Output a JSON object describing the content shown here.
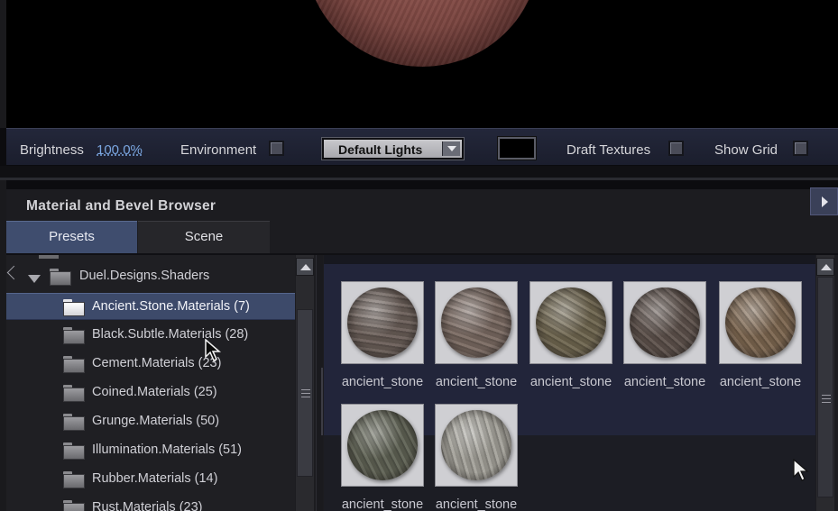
{
  "toolbar": {
    "brightness_label": "Brightness",
    "brightness_value": "100.0%",
    "environment_label": "Environment",
    "lights_dropdown": "Default Lights",
    "draft_textures_label": "Draft Textures",
    "show_grid_label": "Show Grid"
  },
  "browser": {
    "title": "Material and Bevel Browser",
    "tabs": [
      {
        "label": "Presets",
        "active": true
      },
      {
        "label": "Scene",
        "active": false
      }
    ],
    "tree": {
      "parent": "Duel.Designs.Shaders",
      "items": [
        {
          "label": "Ancient.Stone.Materials (7)",
          "selected": true
        },
        {
          "label": "Black.Subtle.Materials (28)",
          "selected": false
        },
        {
          "label": "Cement.Materials (23)",
          "selected": false
        },
        {
          "label": "Coined.Materials (25)",
          "selected": false
        },
        {
          "label": "Grunge.Materials (50)",
          "selected": false
        },
        {
          "label": "Illumination.Materials (51)",
          "selected": false
        },
        {
          "label": "Rubber.Materials (14)",
          "selected": false
        },
        {
          "label": "Rust.Materials (23)",
          "selected": false
        }
      ]
    },
    "materials": [
      {
        "label": "ancient_stone",
        "tone": "#6a5e58"
      },
      {
        "label": "ancient_stone",
        "tone": "#7a6a62"
      },
      {
        "label": "ancient_stone",
        "tone": "#6f6650"
      },
      {
        "label": "ancient_stone",
        "tone": "#5e524c"
      },
      {
        "label": "ancient_stone",
        "tone": "#7c6650"
      },
      {
        "label": "ancient_stone",
        "tone": "#5f6254"
      },
      {
        "label": "ancient_stone",
        "tone": "#a4a29a"
      }
    ]
  },
  "colors": {
    "accent_tab": "#3f4d6e",
    "toolbar_bg": "#1f2233",
    "link": "#7aa6e0"
  }
}
